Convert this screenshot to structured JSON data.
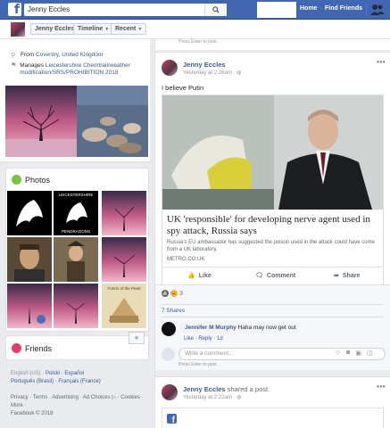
{
  "topbar": {
    "search_value": "Jenny Eccles",
    "nav_home": "Home",
    "nav_find_friends": "Find Friends"
  },
  "profile_nav": {
    "name": "Jenny Eccles",
    "timeline": "Timeline",
    "recent": "Recent"
  },
  "intro": {
    "from_prefix": "From",
    "from_place": "Coventry, United Kingdom",
    "manages_prefix": "Manages",
    "manages_page": "Leicestershire Chemtrail/weather modification/SRS/PROHIBITION 2018"
  },
  "photos": {
    "title": "Photos",
    "tile1_text": "LEICESTERSHIRE",
    "tile2_text": "PENDRAGONS",
    "tile3_text": "Fortris of the Pearl"
  },
  "friends": {
    "title": "Friends"
  },
  "languages": {
    "line1": [
      "English (US)",
      "Polski",
      "Español"
    ],
    "line2": [
      "Português (Brasil)",
      "Français (France)"
    ],
    "plus": "+"
  },
  "footer": {
    "links": "Privacy · Terms · Advertising · Ad Choices ▷ · Cookies ·",
    "more": "More ·",
    "copyright": "Facebook © 2018"
  },
  "prev_hint": "Press Enter to post.",
  "post1": {
    "author": "Jenny Eccles",
    "meta": "Yesterday at 2:26am · ",
    "text": "I believe Putin",
    "link_headline": "UK 'responsible' for developing nerve agent used in spy attack, Russia says",
    "link_desc": "Russia's EU ambassador has suggested the poison used in the attack could have come from a UK laboratory.",
    "link_domain": "METRO.CO.UK",
    "like": "Like",
    "comment": "Comment",
    "share": "Share",
    "reaction_count": "3",
    "shares": "7 Shares",
    "comment_author": "Jennifer M Murphy",
    "comment_text": "Haha may now get out",
    "comment_meta": "Like · Reply · 1d",
    "write_placeholder": "Write a comment...",
    "enter_hint": "Press Enter to post."
  },
  "post2": {
    "author": "Jenny Eccles",
    "action": "shared a post.",
    "meta": "Yesterday at 2:22am · "
  }
}
